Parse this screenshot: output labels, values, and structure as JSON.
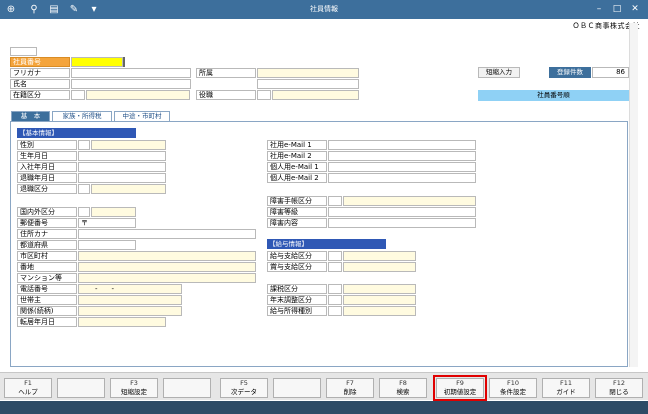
{
  "window": {
    "title": "社員情報",
    "company": "ＯＢＣ商事株式会社",
    "toolbar_icons": [
      "add-icon",
      "zoom-icon",
      "print-icon",
      "pin-icon",
      "menu-down-icon"
    ]
  },
  "header": {
    "emp_no_label": "社員番号",
    "furigana_label": "フリガナ",
    "name_label": "氏名",
    "status_label": "在籍区分",
    "dept_label": "所属",
    "post_label": "役職",
    "short_input_label": "短縮入力",
    "reg_count_label": "登録件数",
    "reg_count_value": "86",
    "order_label": "社員番号順"
  },
  "tabs": [
    "基　本",
    "家族・所得税",
    "中途・市町村"
  ],
  "basic": {
    "header": "【基本情報】",
    "labels": [
      "性別",
      "生年月日",
      "入社年月日",
      "退職年月日",
      "退職区分"
    ]
  },
  "email": {
    "labels": [
      "社用e-Mail 1",
      "社用e-Mail 2",
      "個人用e-Mail 1",
      "個人用e-Mail 2"
    ]
  },
  "address": {
    "labels": [
      "国内外区分",
      "郵便番号",
      "住所カナ",
      "都道府県",
      "市区町村",
      "番地",
      "マンション等",
      "電話番号",
      "世帯主",
      "関係(続柄)",
      "転居年月日"
    ],
    "postal_mark": "〒",
    "phone_value": "-　　-"
  },
  "disability": {
    "labels": [
      "障害手帳区分",
      "障害等級",
      "障害内容"
    ]
  },
  "salary": {
    "header": "【給与情報】",
    "labels": [
      "給与支給区分",
      "賞与支給区分"
    ],
    "labels2": [
      "課税区分",
      "年末調整区分",
      "給与所得種別"
    ]
  },
  "fkeys": [
    {
      "key": "F1",
      "label": "ヘルプ"
    },
    {
      "key": "",
      "label": ""
    },
    {
      "key": "F3",
      "label": "短縮設定"
    },
    {
      "key": "",
      "label": ""
    },
    {
      "key": "F5",
      "label": "次データ"
    },
    {
      "key": "",
      "label": ""
    },
    {
      "key": "F7",
      "label": "削除"
    },
    {
      "key": "F8",
      "label": "検索"
    },
    {
      "key": "F9",
      "label": "初期値設定"
    },
    {
      "key": "F10",
      "label": "条件設定"
    },
    {
      "key": "F11",
      "label": "ガイド"
    },
    {
      "key": "F12",
      "label": "閉じる"
    }
  ]
}
